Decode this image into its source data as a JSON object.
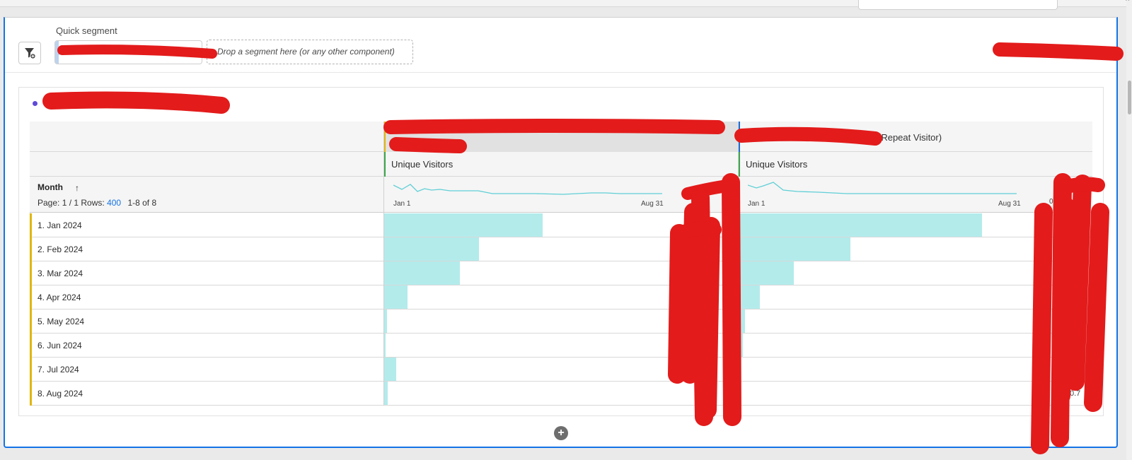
{
  "segment_bar": {
    "label": "Quick segment",
    "drop_placeholder": "Drop a segment here (or any other component)"
  },
  "table": {
    "segment2_suffix": "(Repeat Visitor)",
    "metric_label_1": "Unique Visitors",
    "metric_label_2": "Unique Visitors",
    "dimension_header": "Month",
    "sort_glyph": "↑",
    "pagination": {
      "page_text": "Page: 1 / 1",
      "rows_label": "Rows:",
      "rows_value": "400",
      "range_text": "1-8 of 8"
    },
    "sparkline_start": "Jan 1",
    "sparkline_end": "Aug 31",
    "truncated_values": [
      "0.",
      "0.7"
    ],
    "rows": [
      {
        "label": "1.  Jan 2024",
        "seg1": 1.0,
        "seg2": 1.0
      },
      {
        "label": "2.  Feb 2024",
        "seg1": 0.6,
        "seg2": 0.46
      },
      {
        "label": "3.  Mar 2024",
        "seg1": 0.48,
        "seg2": 0.23
      },
      {
        "label": "4.  Apr 2024",
        "seg1": 0.15,
        "seg2": 0.09
      },
      {
        "label": "5.  May 2024",
        "seg1": 0.02,
        "seg2": 0.03
      },
      {
        "label": "6.  Jun 2024",
        "seg1": 0.015,
        "seg2": 0.02
      },
      {
        "label": "7.  Jul 2024",
        "seg1": 0.08,
        "seg2": 0.015
      },
      {
        "label": "8.  Aug 2024",
        "seg1": 0.025,
        "seg2": 0.015
      }
    ]
  },
  "colors": {
    "accent": "#1473e6",
    "bar_fill": "#b3ebeb",
    "sparkline": "#5fcfd6",
    "row_marker": "#e0b60f",
    "segment1_marker": "#e5b40f",
    "segment2_marker": "#1e6fd9",
    "metric_marker": "#3da74e",
    "redaction": "#e31b1b"
  },
  "icons": {
    "filter": "filter-add-icon",
    "add": "add-circle-icon",
    "sort": "sort-ascending-icon"
  }
}
